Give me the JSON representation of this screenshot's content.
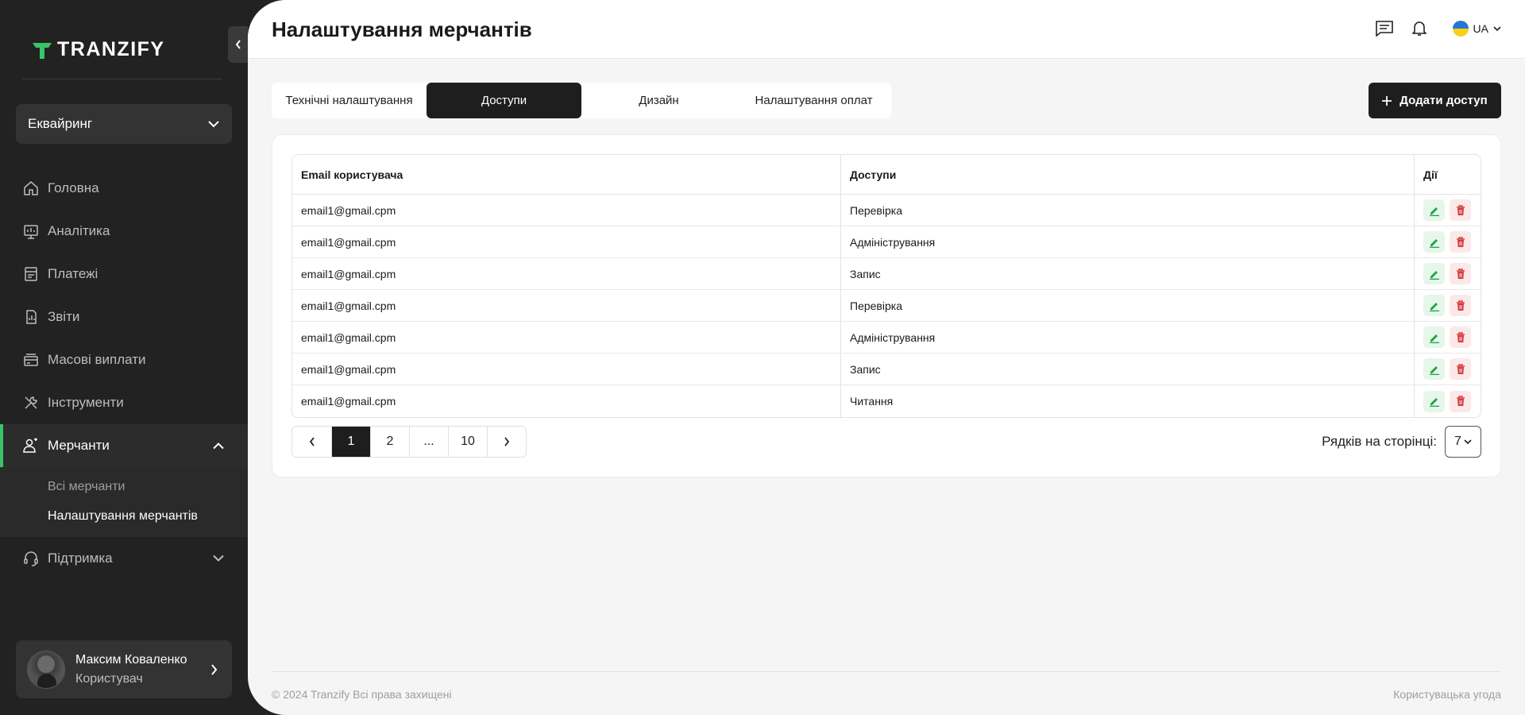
{
  "brand": {
    "name": "TRANZIFY",
    "accent": "#39c46a"
  },
  "sidebar": {
    "product_select": "Еквайринг",
    "items": [
      {
        "label": "Головна",
        "icon": "home-icon"
      },
      {
        "label": "Аналітика",
        "icon": "analytics-icon"
      },
      {
        "label": "Платежі",
        "icon": "payments-icon"
      },
      {
        "label": "Звіти",
        "icon": "reports-icon"
      },
      {
        "label": "Масові виплати",
        "icon": "payouts-icon"
      },
      {
        "label": "Інструменти",
        "icon": "tools-icon"
      },
      {
        "label": "Мерчанти",
        "icon": "merchants-icon"
      },
      {
        "label": "Підтримка",
        "icon": "support-icon"
      }
    ],
    "submenu": [
      "Всі мерчанти",
      "Налаштування мерчантів"
    ],
    "user": {
      "name": "Максим Коваленко",
      "role": "Користувач"
    }
  },
  "header": {
    "title": "Налаштування мерчантів",
    "lang": "UA"
  },
  "tabs": [
    "Технічні налаштування",
    "Доступи",
    "Дизайн",
    "Налаштування оплат"
  ],
  "active_tab": "Доступи",
  "add_button": "Додати доступ",
  "table": {
    "headers": [
      "Email користувача",
      "Доступи",
      "Дії"
    ],
    "rows": [
      {
        "email": "email1@gmail.cpm",
        "access": "Перевірка"
      },
      {
        "email": "email1@gmail.cpm",
        "access": "Адміністрування"
      },
      {
        "email": "email1@gmail.cpm",
        "access": "Запис"
      },
      {
        "email": "email1@gmail.cpm",
        "access": "Перевірка"
      },
      {
        "email": "email1@gmail.cpm",
        "access": "Адміністрування"
      },
      {
        "email": "email1@gmail.cpm",
        "access": "Запис"
      },
      {
        "email": "email1@gmail.cpm",
        "access": "Читання"
      }
    ]
  },
  "pagination": {
    "pages": [
      "1",
      "2",
      "...",
      "10"
    ],
    "current": "1"
  },
  "rows_per_page": {
    "label": "Рядків на сторінці:",
    "value": "7"
  },
  "footer": {
    "copyright": "© 2024 Tranzify Всі права захищені",
    "agreement": "Користувацька угода"
  }
}
